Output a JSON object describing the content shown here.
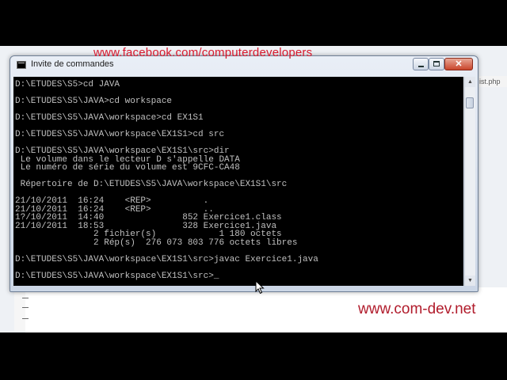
{
  "watermarks": {
    "top": "www.facebook.com/computerdevelopers",
    "bottom": "www.com-dev.net"
  },
  "window": {
    "title": "Invite de commandes",
    "close_label": "✕"
  },
  "background": {
    "tab_label": "ist.php"
  },
  "console_lines": [
    "D:\\ETUDES\\S5>cd JAVA",
    "",
    "D:\\ETUDES\\S5\\JAVA>cd workspace",
    "",
    "D:\\ETUDES\\S5\\JAVA\\workspace>cd EX1S1",
    "",
    "D:\\ETUDES\\S5\\JAVA\\workspace\\EX1S1>cd src",
    "",
    "D:\\ETUDES\\S5\\JAVA\\workspace\\EX1S1\\src>dir",
    " Le volume dans le lecteur D s'appelle DATA",
    " Le numéro de série du volume est 9CFC-CA48",
    "",
    " Répertoire de D:\\ETUDES\\S5\\JAVA\\workspace\\EX1S1\\src",
    "",
    "21/10/2011  16:24    <REP>          .",
    "21/10/2011  16:24    <REP>          ..",
    "1?/10/2011  14:40               852 Exercice1.class",
    "21/10/2011  18:53               328 Exercice1.java",
    "               2 fichier(s)            1 180 octets",
    "               2 Rép(s)  276 073 803 776 octets libres",
    "",
    "D:\\ETUDES\\S5\\JAVA\\workspace\\EX1S1\\src>javac Exercice1.java",
    "",
    "D:\\ETUDES\\S5\\JAVA\\workspace\\EX1S1\\src>_"
  ]
}
